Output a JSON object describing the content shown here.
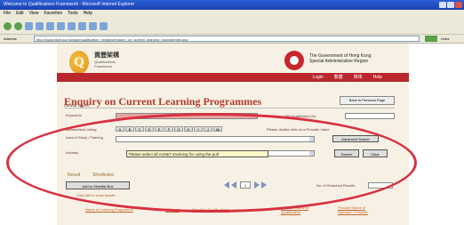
{
  "browser": {
    "title": "Welcome to Qualifications Framework - Microsoft Internet Explorer",
    "menu": [
      "File",
      "Edit",
      "View",
      "Favorites",
      "Tools",
      "Help"
    ],
    "address_label": "Address",
    "address": "http://www.hkqf.gov.hk/guie/qualification_register/enquiry_on_current_learning_programmes.asp",
    "go_label": "Go",
    "links_label": "Links"
  },
  "header": {
    "logo_letter": "Q",
    "logo_cn": "資歷架構",
    "logo_en": "Qualifications\nFramework",
    "govt_name": "The Government of Hong Kong Special Administrative Region",
    "nav": [
      "Login",
      "繁體",
      "简体",
      "Help"
    ]
  },
  "page": {
    "title": "Enquiry on Current Learning Programmes",
    "back_button": "Back to Previous Page",
    "search_section": "General Search",
    "keywords_label": "Keywords",
    "qualification_no_label": "QR Qualification No.",
    "alphabet_hint": "Alphabetical Listing",
    "alphabet": [
      "A",
      "B",
      "C",
      "D",
      "E",
      "F",
      "G",
      "H",
      "I",
      "J",
      "All"
    ],
    "provider_hint": "Please double-click on a Provider name",
    "area_label": "Area of Study / Training",
    "industry_label": "Industry",
    "tooltip": "Please select all AoS&T involving for using the pull",
    "advanced_search": "Advanced Search",
    "search_button": "Search",
    "clear_button": "Clear",
    "tabs": [
      "Result",
      "Shortlisted"
    ],
    "add_shortlist": "Add to Shortlist Box",
    "click_hint": "Click title to show details",
    "page_number": "1",
    "results_label": "No. of Searched Results",
    "footer_links": [
      "Name of Learning Programme",
      "QF Level",
      "Specified Qualifications",
      "Provider Name of Qualification",
      "Provider Name of Operator / Provider"
    ]
  }
}
